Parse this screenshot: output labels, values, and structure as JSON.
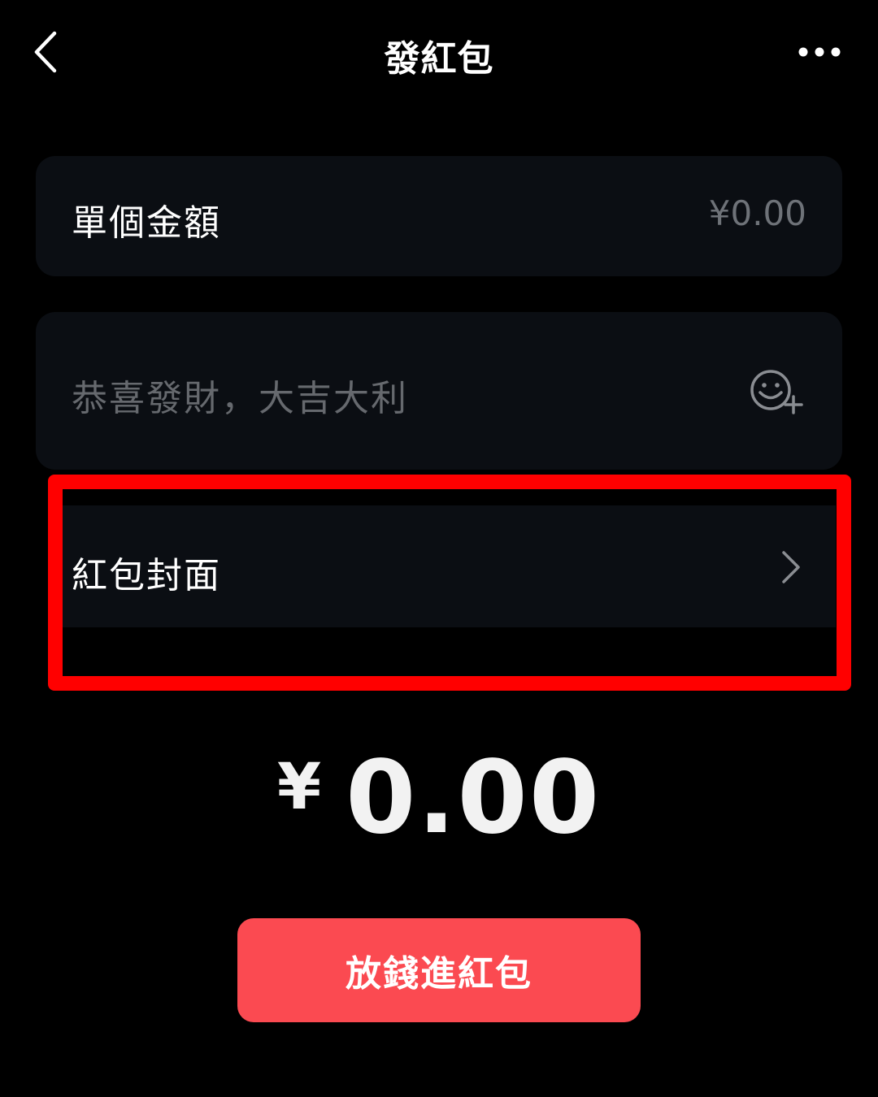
{
  "header": {
    "title": "發紅包",
    "back_icon": "chevron-left-icon",
    "more_icon": "more-horizontal-icon"
  },
  "amount": {
    "label": "單個金額",
    "value": "¥0.00"
  },
  "message": {
    "placeholder": "恭喜發財，大吉大利",
    "value": "",
    "emoji_icon": "emoji-add-icon"
  },
  "cover": {
    "label": "紅包封面",
    "chevron_icon": "chevron-right-icon"
  },
  "total": {
    "currency": "¥",
    "value": "0.00"
  },
  "submit": {
    "label": "放錢進紅包"
  },
  "colors": {
    "background": "#000000",
    "card": "#0b0e13",
    "accent": "#fb4a51",
    "highlight": "#ff0000",
    "muted_text": "#6e7278"
  }
}
